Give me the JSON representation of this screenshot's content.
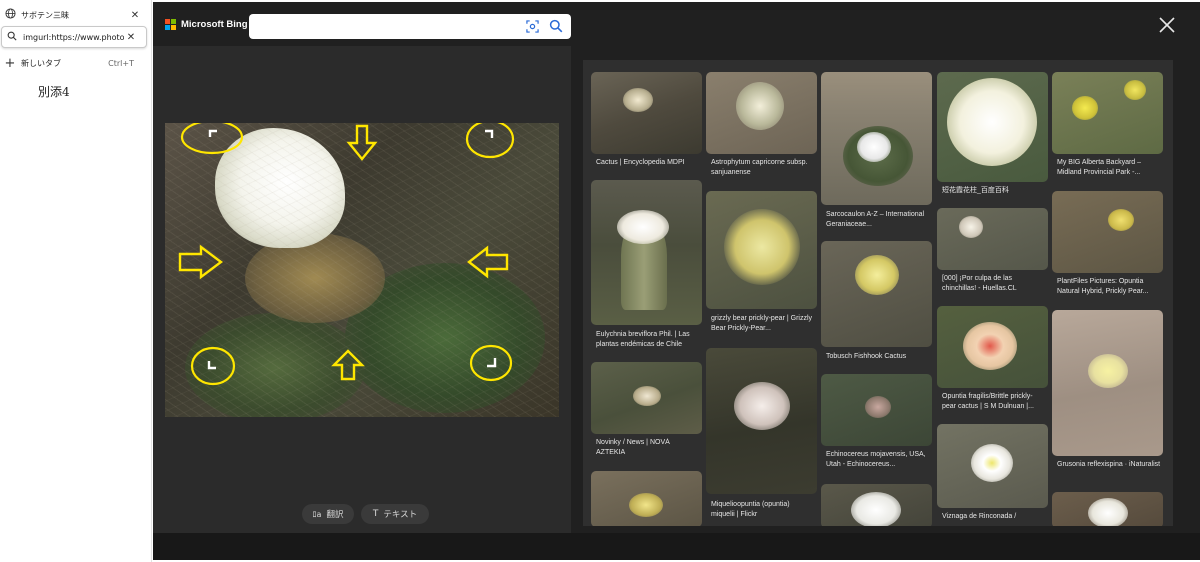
{
  "sidebar": {
    "tabs": [
      {
        "label": "サボテン三昧",
        "icon": "globe-icon"
      },
      {
        "label": "imgurl:https://www.photobb.net/",
        "icon": "search-icon"
      },
      {
        "label": "新しいタブ",
        "icon": "plus-icon",
        "shortcut": "Ctrl+T"
      }
    ],
    "note": "別添4"
  },
  "bing": {
    "brand": "Microsoft Bing",
    "search_placeholder": "",
    "actions": {
      "translate": "翻訳",
      "text": "テキスト"
    },
    "results": [
      {
        "caption": "Cactus | Encyclopedia MDPI"
      },
      {
        "caption": "Eulychnia breviflora Phil. | Las plantas endémicas de Chile"
      },
      {
        "caption": "Novinky / News | NOVÁ AZTEKIA"
      },
      {
        "caption": ""
      },
      {
        "caption": "Astrophytum capricorne subsp. sanjuanense"
      },
      {
        "caption": "grizzly bear prickly-pear | Grizzly Bear Prickly-Pear..."
      },
      {
        "caption": "Miquelioopuntia (opuntia) miquelii | Flickr"
      },
      {
        "caption": "Sarcocaulon A-Z – International Geraniaceae..."
      },
      {
        "caption": "Tobusch Fishhook Cactus"
      },
      {
        "caption": "Echinocereus mojavensis, USA, Utah - Echinocereus..."
      },
      {
        "caption": ""
      },
      {
        "caption": "短花霞花柱_百度百科"
      },
      {
        "caption": "[000] ¡Por culpa de las chinchillas! - Huellas.CL"
      },
      {
        "caption": "Opuntia fragilis/Brittle prickly-pear cactus | S M Dulnuan |..."
      },
      {
        "caption": "Viznaga de Rinconada /"
      },
      {
        "caption": "My BIG Alberta Backyard – Midland Provincial Park -..."
      },
      {
        "caption": "PlantFiles Pictures: Opuntia Natural Hybrid, Prickly Pear..."
      },
      {
        "caption": "Grusonia reflexispina · iNaturalist"
      },
      {
        "caption": ""
      }
    ]
  },
  "colors": {
    "panel": "#202020",
    "highlight": "#ffe600"
  }
}
